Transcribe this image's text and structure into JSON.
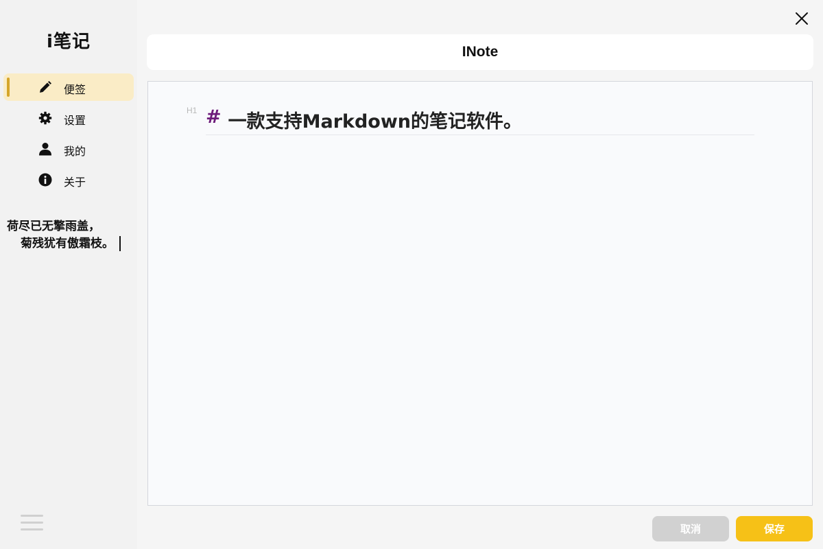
{
  "app": {
    "title": "i笔记"
  },
  "sidebar": {
    "items": [
      {
        "label": "便签",
        "icon": "pencil-icon",
        "active": true
      },
      {
        "label": "设置",
        "icon": "gear-icon",
        "active": false
      },
      {
        "label": "我的",
        "icon": "user-icon",
        "active": false
      },
      {
        "label": "关于",
        "icon": "info-icon",
        "active": false
      }
    ],
    "poem": {
      "line1": "荷尽已无擎雨盖，",
      "line2": "菊残犹有傲霜枝。"
    },
    "menu_icon": "hamburger-menu-icon"
  },
  "window": {
    "close_icon": "close-icon"
  },
  "header": {
    "title": "INote"
  },
  "editor": {
    "heading_badge": "H1",
    "heading_marker": "#",
    "heading_text": "一款支持Markdown的笔记软件。"
  },
  "actions": {
    "cancel_label": "取消",
    "save_label": "保存"
  },
  "colors": {
    "accent": "#f6c117",
    "active_bg": "#faecc6",
    "indicator": "#d5a52a",
    "heading_marker": "#6d1a7a"
  }
}
